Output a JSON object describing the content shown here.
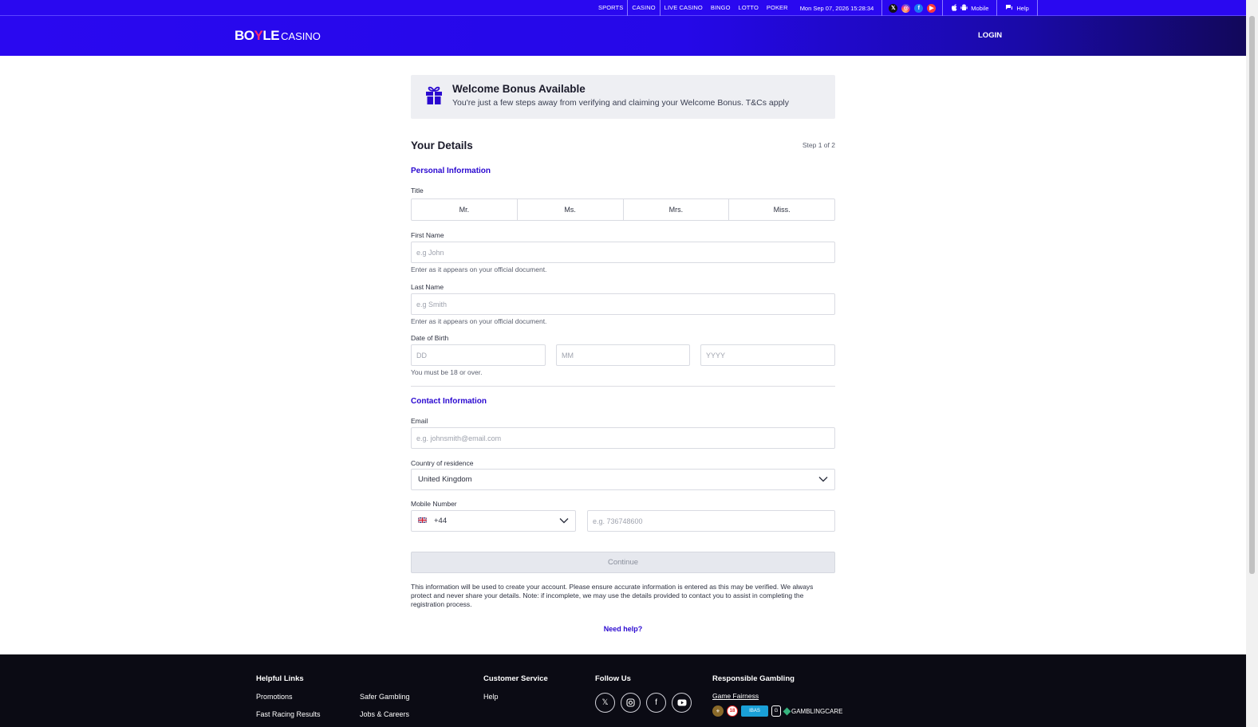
{
  "topbar": {
    "nav": [
      "SPORTS",
      "CASINO",
      "LIVE CASINO",
      "BINGO",
      "LOTTO",
      "POKER"
    ],
    "datetime": "Mon Sep 07, 2026 15:28:34",
    "mobile_label": "Mobile",
    "help_label": "Help"
  },
  "header": {
    "logo_left": "BO",
    "logo_y": "Y",
    "logo_right": "LE",
    "logo_casino": "CASINO",
    "login_label": "LOGIN"
  },
  "bonus": {
    "title": "Welcome Bonus Available",
    "text": "You're just a few steps away from verifying and claiming your Welcome Bonus. T&Cs apply"
  },
  "details": {
    "heading": "Your Details",
    "step": "Step 1 of 2"
  },
  "personal": {
    "section_title": "Personal Information",
    "title_label": "Title",
    "title_options": [
      "Mr.",
      "Ms.",
      "Mrs.",
      "Miss."
    ],
    "first_name_label": "First Name",
    "first_name_placeholder": "e.g John",
    "first_name_hint": "Enter as it appears on your official document.",
    "last_name_label": "Last Name",
    "last_name_placeholder": "e.g Smith",
    "last_name_hint": "Enter as it appears on your official document.",
    "dob_label": "Date of Birth",
    "dob_dd": "DD",
    "dob_mm": "MM",
    "dob_yyyy": "YYYY",
    "dob_hint": "You must be 18 or over."
  },
  "contact": {
    "section_title": "Contact Information",
    "email_label": "Email",
    "email_placeholder": "e.g. johnsmith@email.com",
    "country_label": "Country of residence",
    "country_value": "United Kingdom",
    "mobile_label": "Mobile Number",
    "dial_code": "+44",
    "mobile_placeholder": "e.g. 736748600"
  },
  "actions": {
    "continue_label": "Continue",
    "disclaimer": "This information will be used to create your account. Please ensure accurate information is entered as this may be verified. We always protect and never share your details. Note: if incomplete, we may use the details provided to contact you to assist in completing the registration process.",
    "need_help": "Need help?"
  },
  "footer": {
    "helpful_links_title": "Helpful Links",
    "helpful_links": [
      "Promotions",
      "Safer Gambling",
      "Fast Racing Results",
      "Jobs & Careers"
    ],
    "customer_service_title": "Customer Service",
    "customer_service_links": [
      "Help"
    ],
    "follow_us_title": "Follow Us",
    "responsible_title": "Responsible Gambling",
    "game_fairness": "Game Fairness",
    "gamblingcare": "GAMBLINGCARE"
  },
  "colors": {
    "brand": "#2a08f0",
    "accent_text": "#2a08d0",
    "footer_bg": "#0b0b14"
  },
  "icons": [
    "x-icon",
    "instagram-icon",
    "facebook-icon",
    "youtube-icon",
    "apple-icon",
    "android-icon",
    "chat-icon",
    "gift-icon",
    "chevron-down-icon",
    "uk-flag-icon"
  ]
}
